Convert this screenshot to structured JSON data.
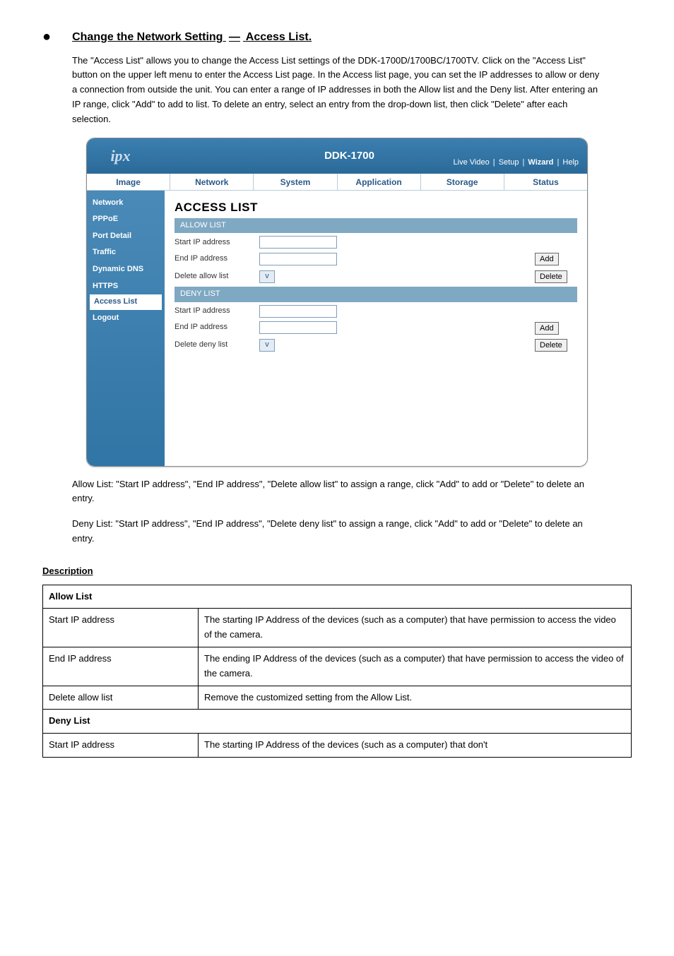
{
  "section": {
    "title_left": "Change the Network Setting",
    "dash": "—",
    "title_right": "Access List.",
    "p1": "The \"Access List\" allows you to change the Access List settings of the DDK-1700D/1700BC/1700TV. Click on the \"Access List\" button on the upper left menu to enter the Access List page. In the Access list page, you can set the IP addresses to allow or deny a connection from outside the unit. You can enter a range of IP addresses in both the Allow list and the Deny list. After entering an IP range, click \"Add\" to add to list. To delete an entry, select an entry from the drop-down list, then click \"Delete\" after each selection."
  },
  "screenshot": {
    "logo": "ip",
    "logo_suffix": "x",
    "product": "DDK-1700",
    "toplinks": [
      "Live Video",
      "Setup",
      "Wizard",
      "Help"
    ],
    "tabs": [
      "Image",
      "Network",
      "System",
      "Application",
      "Storage",
      "Status"
    ],
    "sidebar": [
      "Network",
      "PPPoE",
      "Port Detail",
      "Traffic",
      "Dynamic DNS",
      "HTTPS",
      "Access List",
      "Logout"
    ],
    "main_title": "ACCESS LIST",
    "allow_sec": "ALLOW LIST",
    "deny_sec": "DENY LIST",
    "lbl_start": "Start IP address",
    "lbl_end": "End IP address",
    "lbl_del_allow": "Delete allow list",
    "lbl_del_deny": "Delete deny list",
    "btn_add": "Add",
    "btn_delete": "Delete",
    "chev": "v"
  },
  "instructions": {
    "i1": "Allow List: \"Start IP address\", \"End IP address\", \"Delete allow list\" to assign a range, click \"Add\" to add or \"Delete\" to delete an entry.",
    "i2": "Deny List: \"Start IP address\", \"End IP address\", \"Delete deny list\" to assign a range, click \"Add\" to add or \"Delete\" to delete an entry."
  },
  "desc": {
    "title": "Description",
    "allow_header": "Allow List",
    "deny_header": "Deny List",
    "rows": [
      {
        "c1": "Start IP address",
        "c2": "The starting IP Address of the devices (such as a computer) that have permission to access the video of the camera."
      },
      {
        "c1": "End IP address",
        "c2": "The ending IP Address of the devices (such as a computer) that have permission to access the video of the camera."
      },
      {
        "c1": "Delete allow list",
        "c2": "Remove the customized setting from the Allow List."
      }
    ],
    "deny_row": {
      "c1": "Start IP address",
      "c2": "The starting IP Address of the devices (such as a computer) that don't"
    }
  }
}
